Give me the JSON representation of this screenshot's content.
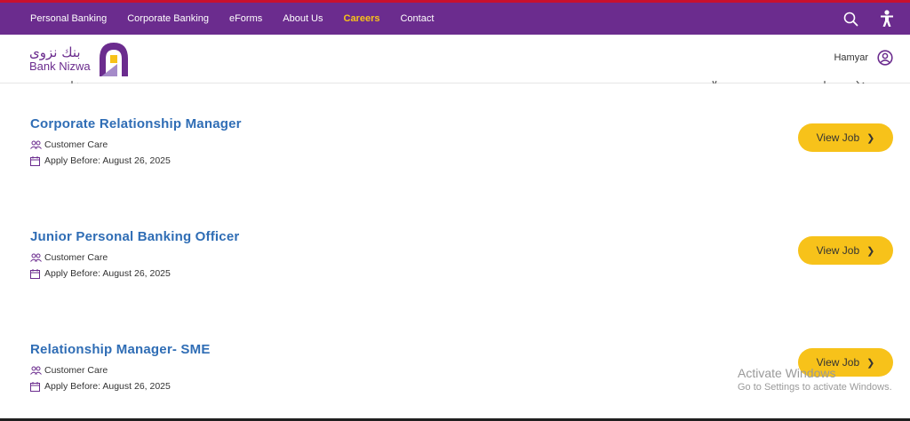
{
  "nav": {
    "items": [
      {
        "label": "Personal Banking"
      },
      {
        "label": "Corporate Banking"
      },
      {
        "label": "eForms"
      },
      {
        "label": "About Us"
      },
      {
        "label": "Careers"
      },
      {
        "label": "Contact"
      }
    ],
    "active": "Careers"
  },
  "brand": {
    "arabic": "بنك نزوى",
    "latin": "Bank Nizwa",
    "color_purple": "#6b2c8e",
    "color_gold": "#f7c21a",
    "color_red": "#c8102e"
  },
  "user": {
    "name": "Hamyar"
  },
  "jobs": [
    {
      "title": "Corporate Relationship Manager",
      "department": "Customer Care",
      "apply_before": "Apply Before: August 26, 2025",
      "button": "View Job"
    },
    {
      "title": "Junior Personal Banking Officer",
      "department": "Customer Care",
      "apply_before": "Apply Before: August 26, 2025",
      "button": "View Job"
    },
    {
      "title": "Relationship Manager- SME",
      "department": "Customer Care",
      "apply_before": "Apply Before: August 26, 2025",
      "button": "View Job"
    }
  ],
  "watermark": {
    "title": "Activate Windows",
    "subtitle": "Go to Settings to activate Windows."
  },
  "icons": {
    "search": "search-icon",
    "accessibility": "accessibility-icon",
    "user": "user-circle-icon",
    "department": "people-icon",
    "date": "calendar-icon",
    "chevron": "chevron-right-icon"
  }
}
